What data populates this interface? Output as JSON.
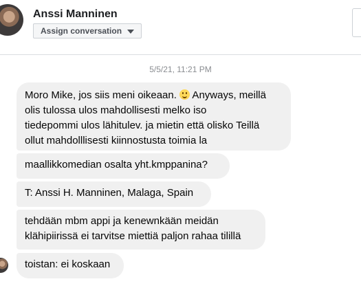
{
  "header": {
    "contact_name": "Anssi Manninen",
    "assign_button": "Assign conversation"
  },
  "thread": {
    "timestamp": "5/5/21, 11:21 PM",
    "messages": [
      {
        "line1a": "Moro Mike, jos siis meni oikeaan.",
        "emoji": "smiling-face-icon",
        "line1b": " Anyways, meillä",
        "line2": "olis tulossa ulos mahdollisesti melko iso",
        "line3": "tiedepommi ulos lähitulev. ja mietin että olisko Teillä",
        "line4": "ollut mahdolllisesti kiinnostusta toimia la"
      },
      {
        "text": "maallikkomedian osalta yht.kmppanina?"
      },
      {
        "text": "T: Anssi H. Manninen, Malaga, Spain"
      },
      {
        "line1": "tehdään mbm appi ja kenewnkään meidän",
        "line2": "klähipiirissä ei tarvitse miettiä paljon rahaa tilillä"
      },
      {
        "text": "toistan: ei koskaan"
      }
    ]
  },
  "colors": {
    "bubble_bg": "#f0f0f0",
    "timestamp": "#8a8d91",
    "divider": "#dadde1"
  }
}
